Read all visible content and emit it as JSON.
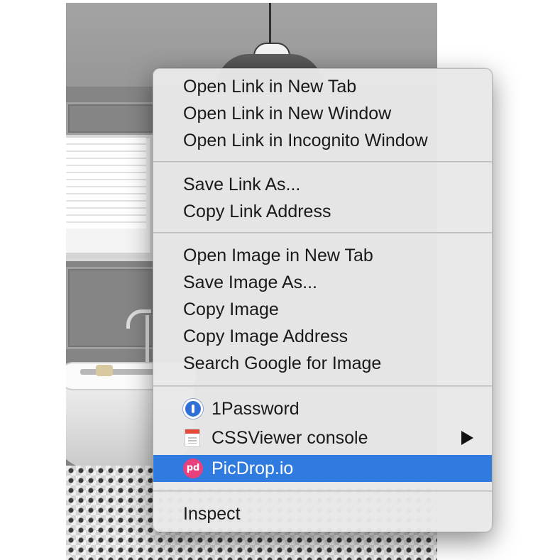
{
  "context_menu": {
    "groups": [
      {
        "items": [
          {
            "label": "Open Link in New Tab"
          },
          {
            "label": "Open Link in New Window"
          },
          {
            "label": "Open Link in Incognito Window"
          }
        ]
      },
      {
        "items": [
          {
            "label": "Save Link As..."
          },
          {
            "label": "Copy Link Address"
          }
        ]
      },
      {
        "items": [
          {
            "label": "Open Image in New Tab"
          },
          {
            "label": "Save Image As..."
          },
          {
            "label": "Copy Image"
          },
          {
            "label": "Copy Image Address"
          },
          {
            "label": "Search Google for Image"
          }
        ]
      },
      {
        "items": [
          {
            "label": "1Password",
            "icon": "1password-icon"
          },
          {
            "label": "CSSViewer console",
            "icon": "cssviewer-icon",
            "has_submenu": true
          },
          {
            "label": "PicDrop.io",
            "icon": "picdrop-icon",
            "highlighted": true
          }
        ]
      },
      {
        "items": [
          {
            "label": "Inspect"
          }
        ]
      }
    ],
    "highlight_color": "#2f7be0",
    "picdrop_icon_text": "pd"
  },
  "background": {
    "description_icon": "bathroom-photo"
  }
}
